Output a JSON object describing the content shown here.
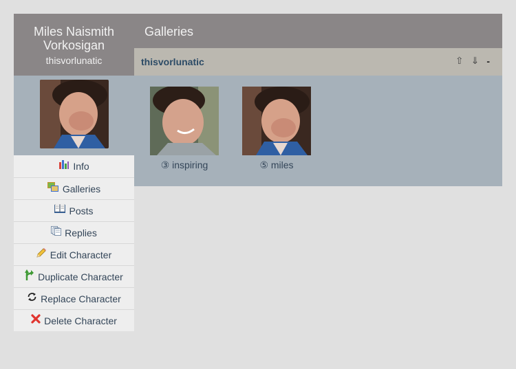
{
  "character": {
    "name": "Miles Naismith Vorkosigan",
    "screenname": "thisvorlunatic"
  },
  "menu": [
    {
      "label": "Info",
      "icon": "bar-chart-icon"
    },
    {
      "label": "Galleries",
      "icon": "gallery-icon"
    },
    {
      "label": "Posts",
      "icon": "book-icon"
    },
    {
      "label": "Replies",
      "icon": "replies-icon"
    },
    {
      "label": "Edit Character",
      "icon": "pencil-icon"
    },
    {
      "label": "Duplicate Character",
      "icon": "branch-icon"
    },
    {
      "label": "Replace Character",
      "icon": "refresh-icon"
    },
    {
      "label": "Delete Character",
      "icon": "delete-icon"
    }
  ],
  "page": {
    "title": "Galleries"
  },
  "gallery": {
    "name": "thisvorlunatic",
    "controls": {
      "up": "⇧",
      "down": "⇓",
      "collapse": "-"
    },
    "icons": [
      {
        "caption": "③ inspiring"
      },
      {
        "caption": "⑤ miles"
      }
    ]
  },
  "colors": {
    "header_bg": "#8a8687",
    "panel_bg": "#a6b1ba",
    "bar_bg": "#bbb8b0",
    "link_text": "#334558"
  }
}
